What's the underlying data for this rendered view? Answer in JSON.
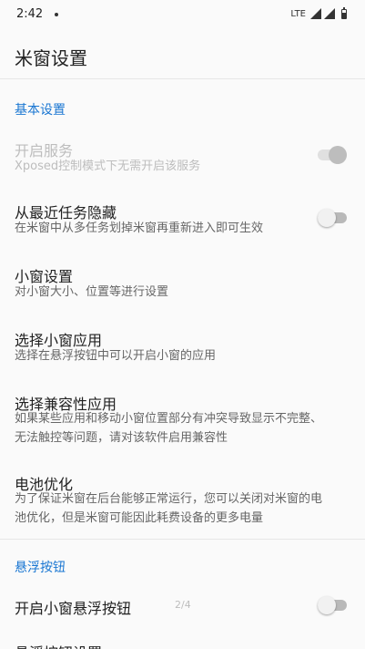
{
  "status_bar": {
    "time": "2:42",
    "network": "LTE"
  },
  "app_bar": {
    "title": "米窗设置"
  },
  "sections": [
    {
      "header": "基本设置",
      "items": [
        {
          "title": "开启服务",
          "summary": "Xposed控制模式下无需开启该服务",
          "switch": "on",
          "enabled": false
        },
        {
          "title": "从最近任务隐藏",
          "summary": "在米窗中从多任务划掉米窗再重新进入即可生效",
          "switch": "off",
          "enabled": true
        },
        {
          "title": "小窗设置",
          "summary": "对小窗大小、位置等进行设置",
          "enabled": true
        },
        {
          "title": "选择小窗应用",
          "summary": "选择在悬浮按钮中可以开启小窗的应用",
          "enabled": true
        },
        {
          "title": "选择兼容性应用",
          "summary": "如果某些应用和移动小窗位置部分有冲突导致显示不完整、无法触控等问题，请对该软件启用兼容性",
          "enabled": true
        },
        {
          "title": "电池优化",
          "summary": "为了保证米窗在后台能够正常运行，您可以关闭对米窗的电池优化，但是米窗可能因此耗费设备的更多电量",
          "enabled": true
        }
      ]
    },
    {
      "header": "悬浮按钮",
      "items": [
        {
          "title": "开启小窗悬浮按钮",
          "switch": "off",
          "enabled": true
        },
        {
          "title": "悬浮按钮设置",
          "enabled": true
        }
      ]
    }
  ],
  "page_indicator": "2/4",
  "colors": {
    "accent": "#1976d2",
    "background": "#fafafa",
    "disabled_text": "#bdbdbd"
  }
}
